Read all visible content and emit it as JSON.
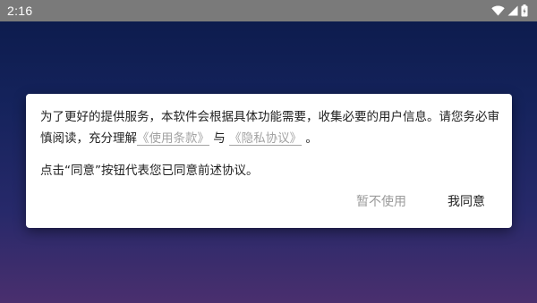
{
  "status_bar": {
    "time": "2:16",
    "icons": [
      "wifi-icon",
      "cell-signal-icon",
      "battery-icon"
    ]
  },
  "dialog": {
    "text_part1": "为了更好的提供服务，本软件会根据具体功能需要，收集必要的用户信息。请您务必审慎阅读，充分理解",
    "terms_link": "《使用条款》",
    "connector": "与",
    "privacy_link": "《隐私协议》",
    "end_punct": "。",
    "consent_text": "点击“同意”按钮代表您已同意前述协议。",
    "decline_label": "暂不使用",
    "accept_label": "我同意"
  },
  "colors": {
    "status_bar_bg": "#7a7a7a",
    "link": "#a3a3a3",
    "decline": "#9b9b9b",
    "text": "#1f1f1f",
    "background_top": "#0b1a4a",
    "background_bottom": "#4a2f6e"
  }
}
